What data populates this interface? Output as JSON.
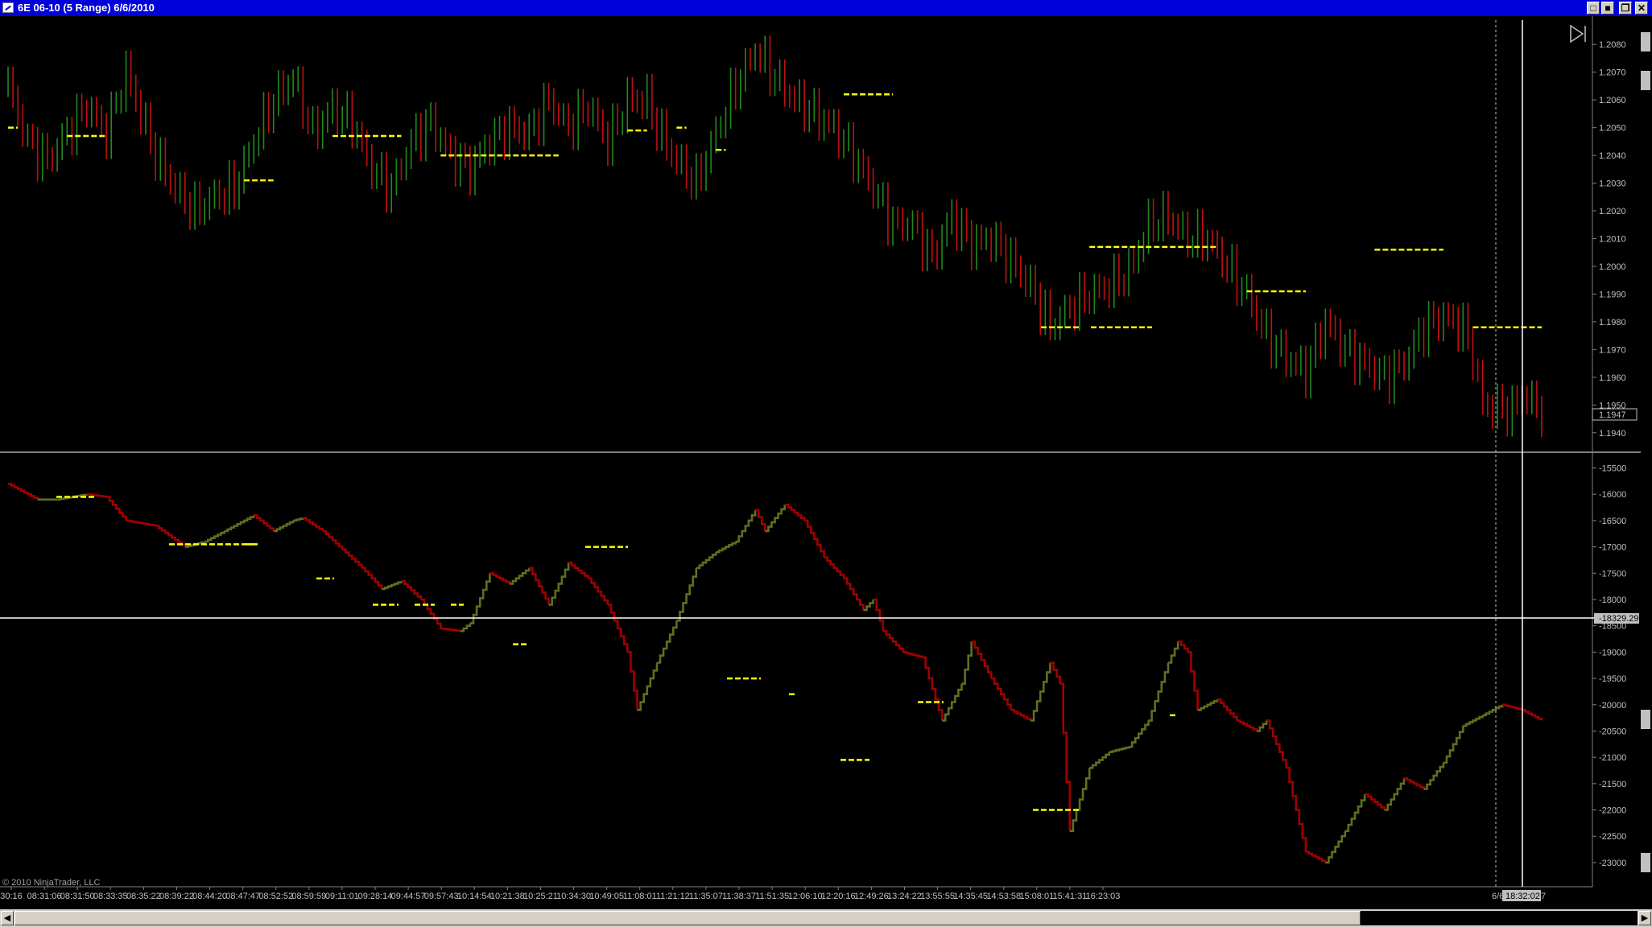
{
  "window": {
    "title": "6E 06-10 (5 Range)  6/6/2010",
    "buttons": [
      "□",
      "■",
      "❐",
      "✕"
    ]
  },
  "price_panel": {
    "y_ticks": [
      "1.2080",
      "1.2070",
      "1.2060",
      "1.2050",
      "1.2040",
      "1.2030",
      "1.2020",
      "1.2010",
      "1.2000",
      "1.1990",
      "1.1980",
      "1.1970",
      "1.1960",
      "1.1950",
      "1.1940"
    ],
    "last_price": "1.1947"
  },
  "indicator_panel": {
    "y_ticks": [
      "-15500",
      "-16000",
      "-16500",
      "-17000",
      "-17500",
      "-18000",
      "-18500",
      "-19000",
      "-19500",
      "-20000",
      "-20500",
      "-21000",
      "-21500",
      "-22000",
      "-22500",
      "-23000"
    ],
    "crosshair_value": "-18329.29"
  },
  "x_axis": {
    "labels": [
      "30:16",
      "08:31:06",
      "08:31:50",
      "08:33:35",
      "08:35:22",
      "08:39:22",
      "08:44:20",
      "08:47:47",
      "08:52:52",
      "08:59:59",
      "09:11:01",
      "09:28:14",
      "09:44:57",
      "09:57:43",
      "10:14:54",
      "10:21:38",
      "10:25:21",
      "10:34:30",
      "10:49:05",
      "11:08:01",
      "11:21:12",
      "11:35:07",
      "11:38:37",
      "11:51:35",
      "12:06:10",
      "12:20:16",
      "12:49:26",
      "13:24:22",
      "13:55:55",
      "14:35:45",
      "14:53:58",
      "15:08:01",
      "15:41:31",
      "16:23:03"
    ],
    "date_stub": "6/6",
    "crosshair_time": "18:32:02",
    "edge_stub": "7"
  },
  "copyright": "© 2010 NinjaTrader, LLC",
  "colors": {
    "up_bar": "#1f8a1f",
    "down_bar": "#c01010",
    "osc_up": "#5f6f1f",
    "osc_down": "#a00000",
    "pivot": "#ffff00",
    "axis_text": "#c0c0c0",
    "crosshair": "#ffffff"
  },
  "icons": [
    "app-icon",
    "minimize-icon",
    "restore-icon",
    "maximize-icon",
    "close-icon",
    "goto-end-icon",
    "scroll-left-icon",
    "scroll-right-icon"
  ],
  "chart_data": [
    {
      "type": "bar",
      "ylim": [
        1.1935,
        1.2085
      ],
      "points": [
        [
          0,
          1.2065
        ],
        [
          2,
          1.2045
        ],
        [
          4,
          1.2038
        ],
        [
          8,
          1.2058
        ],
        [
          10,
          1.2048
        ],
        [
          12,
          1.207
        ],
        [
          15,
          1.204
        ],
        [
          17,
          1.2028
        ],
        [
          19,
          1.202
        ],
        [
          21,
          1.2025
        ],
        [
          23,
          1.2028
        ],
        [
          25,
          1.2045
        ],
        [
          27,
          1.206
        ],
        [
          29,
          1.2068
        ],
        [
          31,
          1.2048
        ],
        [
          33,
          1.2057
        ],
        [
          35,
          1.2052
        ],
        [
          37,
          1.2035
        ],
        [
          39,
          1.2028
        ],
        [
          41,
          1.2045
        ],
        [
          43,
          1.2052
        ],
        [
          45,
          1.204
        ],
        [
          47,
          1.2035
        ],
        [
          49,
          1.2045
        ],
        [
          51,
          1.205
        ],
        [
          53,
          1.2048
        ],
        [
          55,
          1.206
        ],
        [
          57,
          1.205
        ],
        [
          59,
          1.2058
        ],
        [
          61,
          1.2045
        ],
        [
          63,
          1.206
        ],
        [
          65,
          1.206
        ],
        [
          66,
          1.205
        ],
        [
          68,
          1.2038
        ],
        [
          70,
          1.203
        ],
        [
          72,
          1.2048
        ],
        [
          74,
          1.2065
        ],
        [
          76,
          1.2078
        ],
        [
          78,
          1.2068
        ],
        [
          80,
          1.206
        ],
        [
          82,
          1.2055
        ],
        [
          84,
          1.205
        ],
        [
          86,
          1.204
        ],
        [
          88,
          1.2028
        ],
        [
          90,
          1.2015
        ],
        [
          92,
          1.2015
        ],
        [
          94,
          1.2003
        ],
        [
          96,
          1.2018
        ],
        [
          98,
          1.2008
        ],
        [
          100,
          1.201
        ],
        [
          102,
          1.2002
        ],
        [
          104,
          1.1993
        ],
        [
          106,
          1.1978
        ],
        [
          108,
          1.1985
        ],
        [
          110,
          1.199
        ],
        [
          112,
          1.1993
        ],
        [
          114,
          1.1998
        ],
        [
          116,
          1.2015
        ],
        [
          118,
          1.2018
        ],
        [
          120,
          1.201
        ],
        [
          122,
          1.201
        ],
        [
          124,
          1.2
        ],
        [
          126,
          1.199
        ],
        [
          128,
          1.1975
        ],
        [
          130,
          1.1967
        ],
        [
          132,
          1.1962
        ],
        [
          134,
          1.198
        ],
        [
          136,
          1.197
        ],
        [
          138,
          1.1965
        ],
        [
          140,
          1.196
        ],
        [
          142,
          1.1965
        ],
        [
          144,
          1.1978
        ],
        [
          146,
          1.1982
        ],
        [
          148,
          1.1978
        ],
        [
          149,
          1.1968
        ],
        [
          150,
          1.195
        ],
        [
          153,
          1.1948
        ],
        [
          154,
          1.1954
        ],
        [
          156,
          1.1948
        ]
      ]
    },
    {
      "type": "line",
      "ylim": [
        -23200,
        -15400
      ],
      "points": [
        [
          0,
          -15800
        ],
        [
          3,
          -16100
        ],
        [
          5,
          -16100
        ],
        [
          8,
          -16000
        ],
        [
          10,
          -16050
        ],
        [
          12,
          -16500
        ],
        [
          15,
          -16600
        ],
        [
          18,
          -17000
        ],
        [
          20,
          -16900
        ],
        [
          22,
          -16700
        ],
        [
          25,
          -16400
        ],
        [
          27,
          -16700
        ],
        [
          29,
          -16500
        ],
        [
          30,
          -16450
        ],
        [
          32,
          -16700
        ],
        [
          34,
          -17050
        ],
        [
          36,
          -17400
        ],
        [
          38,
          -17800
        ],
        [
          40,
          -17650
        ],
        [
          42,
          -18000
        ],
        [
          44,
          -18550
        ],
        [
          46,
          -18600
        ],
        [
          47,
          -18450
        ],
        [
          49,
          -17500
        ],
        [
          51,
          -17700
        ],
        [
          53,
          -17400
        ],
        [
          55,
          -18100
        ],
        [
          57,
          -17300
        ],
        [
          59,
          -17600
        ],
        [
          61,
          -18100
        ],
        [
          63,
          -19000
        ],
        [
          64,
          -20100
        ],
        [
          66,
          -19200
        ],
        [
          68,
          -18400
        ],
        [
          70,
          -17400
        ],
        [
          72,
          -17100
        ],
        [
          74,
          -16900
        ],
        [
          76,
          -16300
        ],
        [
          77,
          -16700
        ],
        [
          79,
          -16200
        ],
        [
          81,
          -16500
        ],
        [
          83,
          -17200
        ],
        [
          85,
          -17600
        ],
        [
          87,
          -18200
        ],
        [
          88,
          -18000
        ],
        [
          89,
          -18600
        ],
        [
          91,
          -19000
        ],
        [
          93,
          -19100
        ],
        [
          95,
          -20300
        ],
        [
          97,
          -19600
        ],
        [
          98,
          -18800
        ],
        [
          100,
          -19500
        ],
        [
          102,
          -20100
        ],
        [
          104,
          -20300
        ],
        [
          106,
          -19200
        ],
        [
          107,
          -19600
        ],
        [
          108,
          -22400
        ],
        [
          110,
          -21200
        ],
        [
          112,
          -20900
        ],
        [
          114,
          -20800
        ],
        [
          116,
          -20300
        ],
        [
          118,
          -19200
        ],
        [
          119,
          -18800
        ],
        [
          120,
          -19000
        ],
        [
          121,
          -20100
        ],
        [
          123,
          -19900
        ],
        [
          125,
          -20300
        ],
        [
          127,
          -20500
        ],
        [
          128,
          -20300
        ],
        [
          130,
          -21200
        ],
        [
          132,
          -22800
        ],
        [
          134,
          -23000
        ],
        [
          136,
          -22400
        ],
        [
          138,
          -21700
        ],
        [
          140,
          -22000
        ],
        [
          142,
          -21400
        ],
        [
          144,
          -21600
        ],
        [
          146,
          -21100
        ],
        [
          148,
          -20400
        ],
        [
          150,
          -20200
        ],
        [
          152,
          -20000
        ],
        [
          154,
          -20100
        ],
        [
          156,
          -20300
        ]
      ]
    }
  ]
}
